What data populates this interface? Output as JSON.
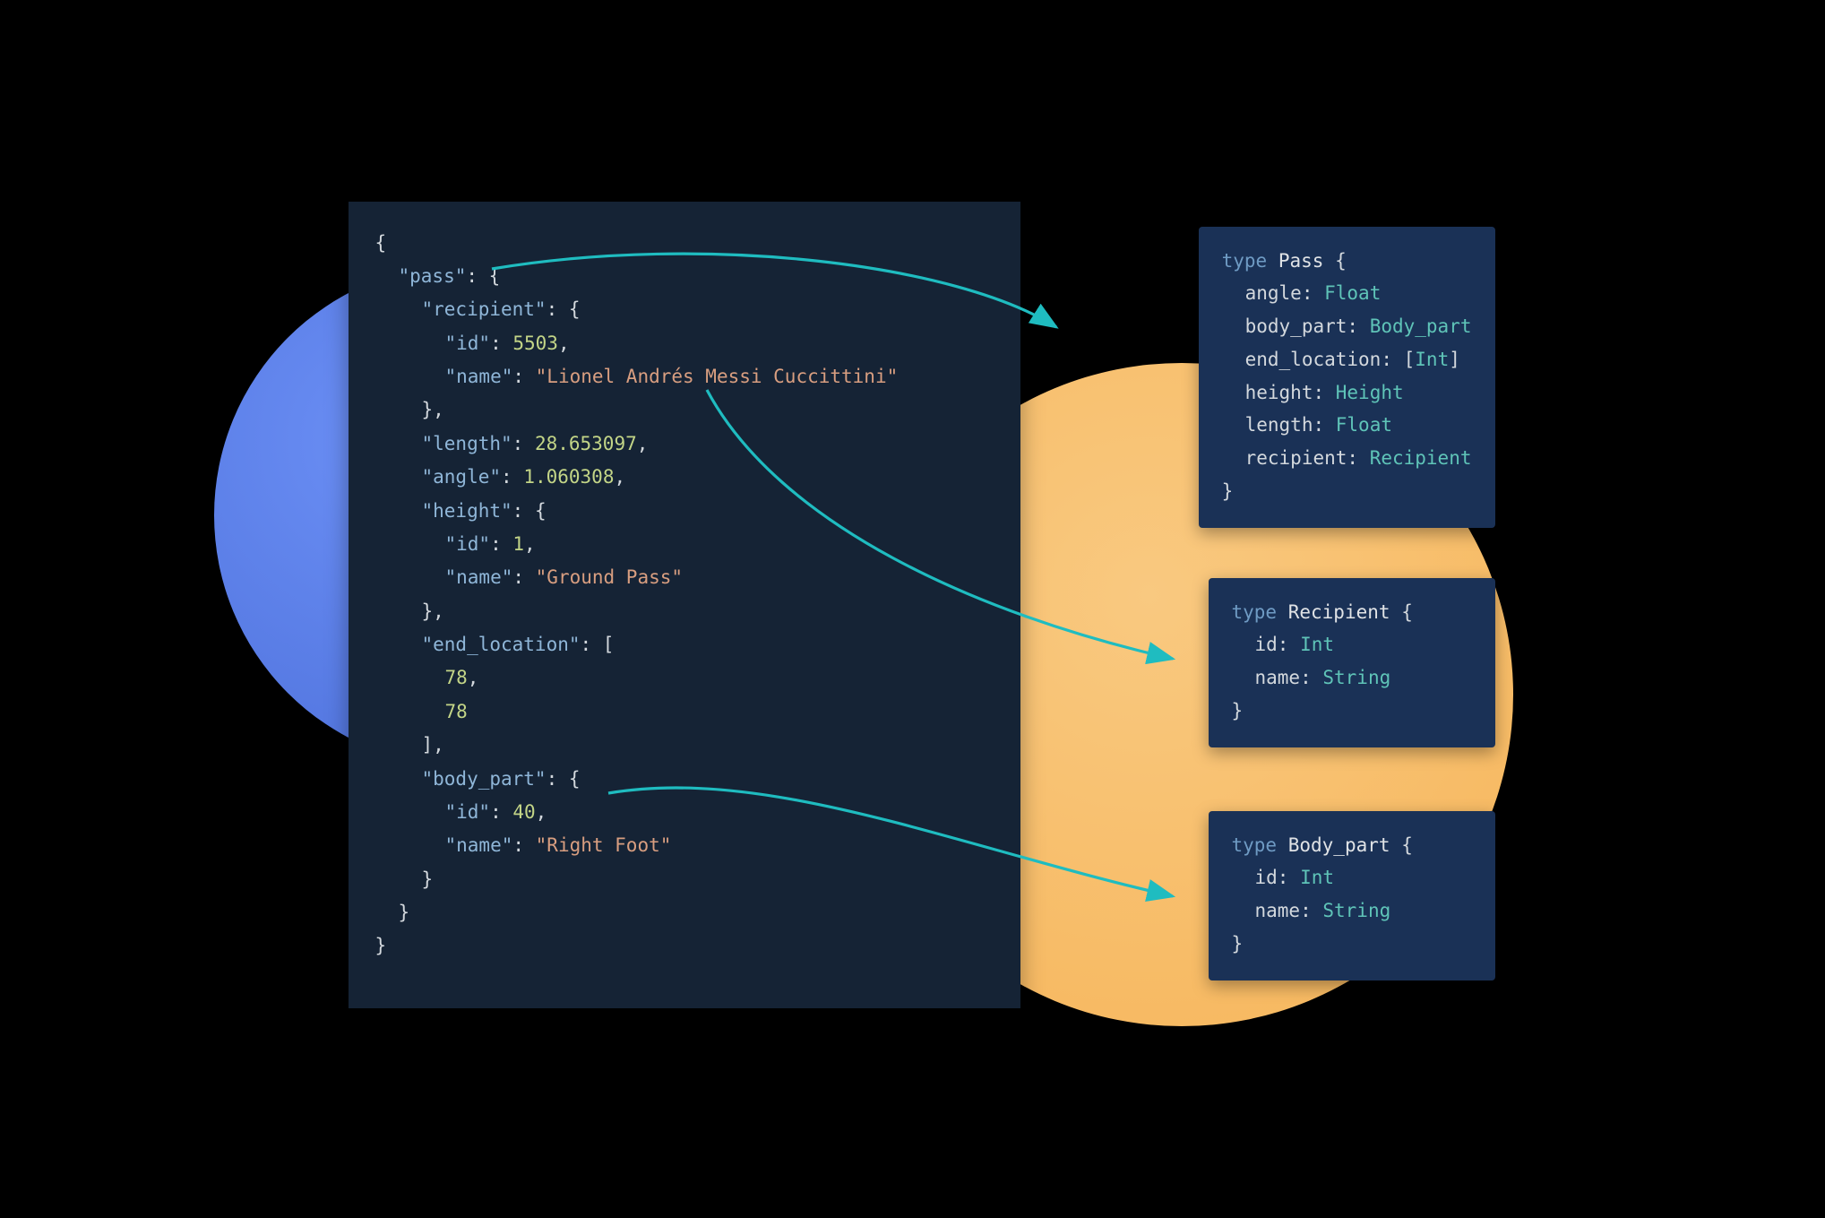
{
  "json": {
    "open_brace": "{",
    "pass_key": "\"pass\"",
    "colon_brace": ": {",
    "recipient_key": "\"recipient\"",
    "id_key": "\"id\"",
    "id_val": "5503",
    "comma": ",",
    "name_key": "\"name\"",
    "recipient_name_val": "\"Lionel Andrés Messi Cuccittini\"",
    "close_brace_comma": "},",
    "length_key": "\"length\"",
    "length_val": "28.653097",
    "angle_key": "\"angle\"",
    "angle_val": "1.060308",
    "height_key": "\"height\"",
    "height_id_val": "1",
    "height_name_val": "\"Ground Pass\"",
    "end_location_key": "\"end_location\"",
    "colon_bracket": ": [",
    "end_loc_0": "78",
    "end_loc_1": "78",
    "close_bracket_comma": "],",
    "body_part_key": "\"body_part\"",
    "body_part_id_val": "40",
    "body_part_name_val": "\"Right Foot\"",
    "close_brace": "}",
    "colon": ": "
  },
  "schema": {
    "type_kw": "type",
    "open": " {",
    "close": "}",
    "colon": ": ",
    "pass": {
      "name": "Pass",
      "f1": "angle",
      "t1": "Float",
      "f2": "body_part",
      "t2": "Body_part",
      "f3": "end_location",
      "t3_open": "[",
      "t3_inner": "Int",
      "t3_close": "]",
      "f4": "height",
      "t4": "Height",
      "f5": "length",
      "t5": "Float",
      "f6": "recipient",
      "t6": "Recipient"
    },
    "recipient": {
      "name": "Recipient",
      "f1": "id",
      "t1": "Int",
      "f2": "name",
      "t2": "String"
    },
    "body_part": {
      "name": "Body_part",
      "f1": "id",
      "t1": "Int",
      "f2": "name",
      "t2": "String"
    }
  },
  "colors": {
    "arrow": "#1fbcc0"
  }
}
